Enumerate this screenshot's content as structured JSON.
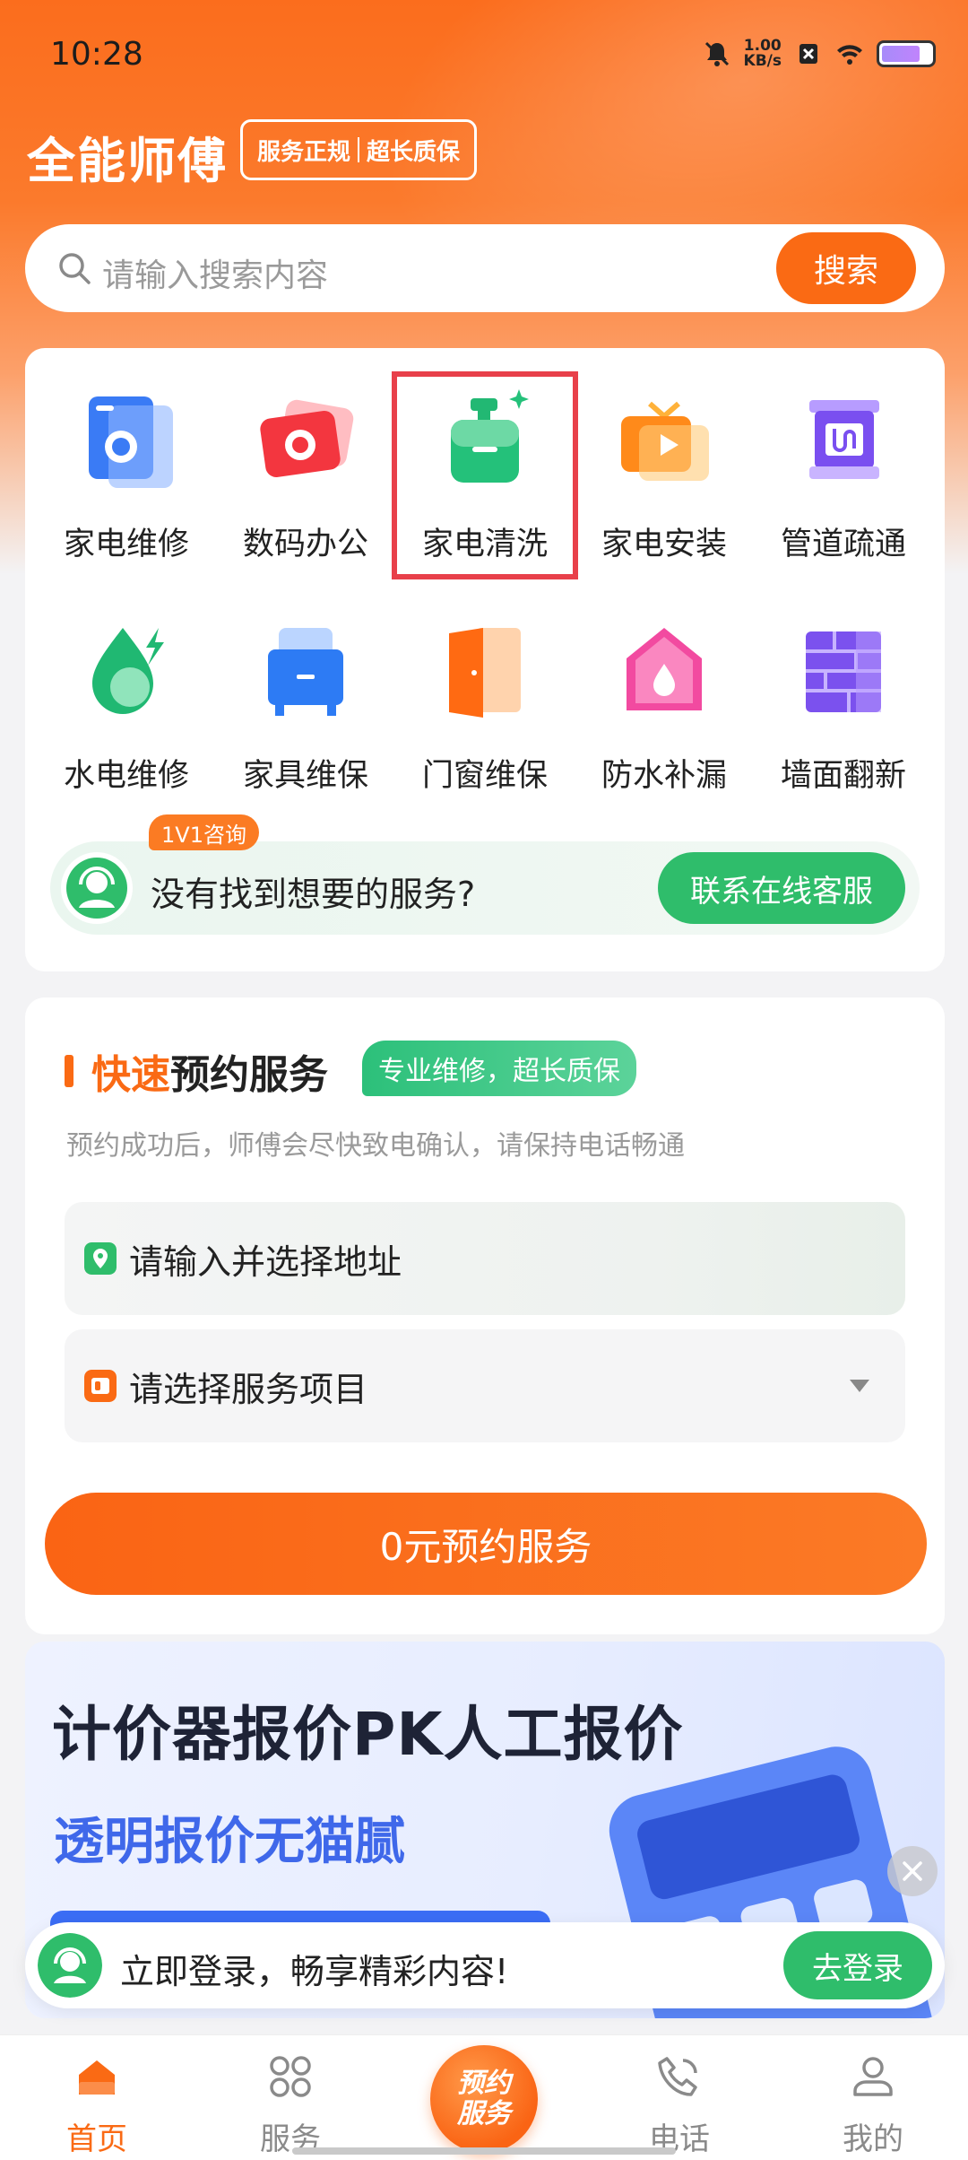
{
  "status_bar": {
    "time": "10:28",
    "net_speed_value": "1.00",
    "net_speed_unit": "KB/s"
  },
  "header": {
    "title": "全能师傅",
    "badge_left": "服务正规",
    "badge_right": "超长质保"
  },
  "search": {
    "placeholder": "请输入搜索内容",
    "button_label": "搜索"
  },
  "services": [
    {
      "label": "家电维修",
      "icon": "washing-machine-icon",
      "selected": false
    },
    {
      "label": "数码办公",
      "icon": "camera-icon",
      "selected": false
    },
    {
      "label": "家电清洗",
      "icon": "cleaning-bottle-icon",
      "selected": true
    },
    {
      "label": "家电安装",
      "icon": "tv-play-icon",
      "selected": false
    },
    {
      "label": "管道疏通",
      "icon": "pipe-icon",
      "selected": false
    },
    {
      "label": "水电维修",
      "icon": "water-drop-lightning-icon",
      "selected": false
    },
    {
      "label": "家具维保",
      "icon": "cabinet-icon",
      "selected": false
    },
    {
      "label": "门窗维保",
      "icon": "door-icon",
      "selected": false
    },
    {
      "label": "防水补漏",
      "icon": "house-drop-icon",
      "selected": false
    },
    {
      "label": "墙面翻新",
      "icon": "brick-wall-icon",
      "selected": false
    }
  ],
  "consult": {
    "badge": "1V1咨询",
    "text": "没有找到想要的服务?",
    "button_label": "联系在线客服"
  },
  "booking": {
    "title_highlight": "快速",
    "title_rest": "预约服务",
    "tag": "专业维修，超长质保",
    "subtitle": "预约成功后，师傅会尽快致电确认，请保持电话畅通",
    "address_placeholder": "请输入并选择地址",
    "service_placeholder": "请选择服务项目",
    "submit_label": "0元预约服务"
  },
  "banner": {
    "title": "计价器报价PK人工报价",
    "subtitle": "透明报价无猫腻"
  },
  "login_prompt": {
    "text": "立即登录，畅享精彩内容!",
    "button_label": "去登录"
  },
  "bottom_nav": {
    "items": [
      {
        "label": "首页",
        "icon": "home-icon",
        "active": true
      },
      {
        "label": "服务",
        "icon": "grid-icon",
        "active": false
      },
      {
        "label": "电话",
        "icon": "phone-icon",
        "active": false
      },
      {
        "label": "我的",
        "icon": "user-icon",
        "active": false
      }
    ],
    "center_line1": "预约",
    "center_line2": "服务"
  },
  "colors": {
    "brand_orange": "#fa6a14",
    "accent_green": "#2fbd6b",
    "highlight_red": "#e8404a"
  }
}
